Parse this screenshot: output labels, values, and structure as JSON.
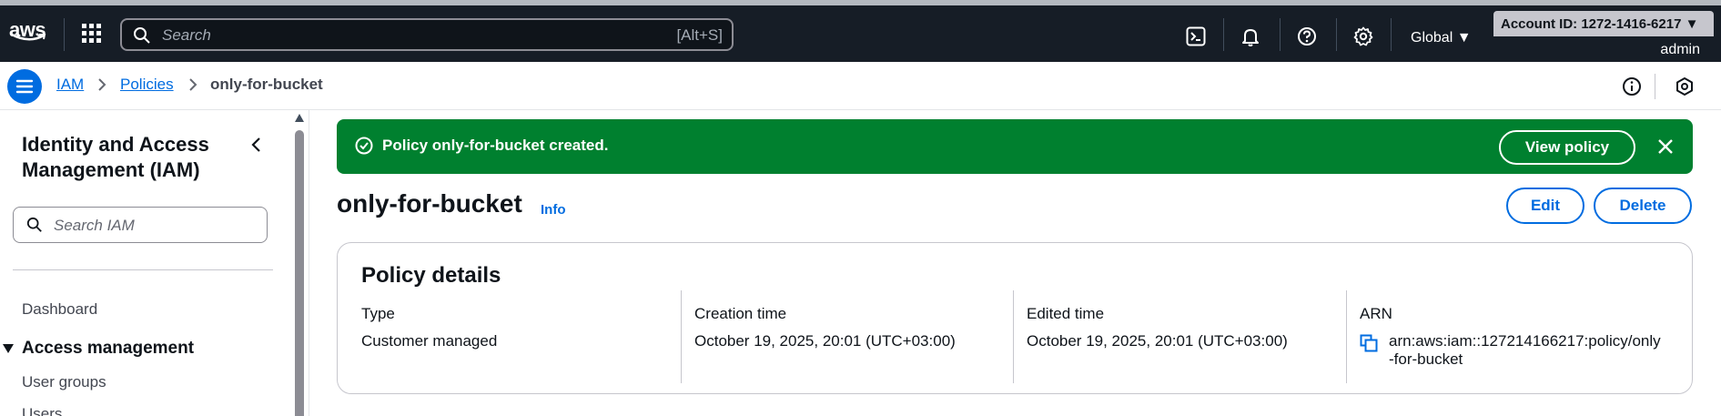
{
  "topnav": {
    "logo": "aws",
    "search_placeholder": "Search",
    "search_shortcut": "[Alt+S]",
    "region": "Global ▼",
    "account": "Account ID: 1272-1416-6217 ▼",
    "user": "admin",
    "icons": [
      "services-grid-icon",
      "cloudshell-icon",
      "bell-icon",
      "help-icon",
      "gear-icon"
    ]
  },
  "breadcrumb": {
    "items": [
      "IAM",
      "Policies",
      "only-for-bucket"
    ]
  },
  "sidebar": {
    "title": "Identity and Access Management (IAM)",
    "search_placeholder": "Search IAM",
    "items": {
      "dashboard": "Dashboard",
      "access_management": "Access management",
      "user_groups": "User groups",
      "users": "Users"
    }
  },
  "flash": {
    "message": "Policy only-for-bucket created.",
    "action": "View policy",
    "color": "#00802f"
  },
  "page": {
    "title": "only-for-bucket",
    "info": "Info",
    "edit": "Edit",
    "delete": "Delete"
  },
  "details": {
    "title": "Policy details",
    "type_label": "Type",
    "type_value": "Customer managed",
    "creation_label": "Creation time",
    "creation_value": "October 19, 2025, 20:01 (UTC+03:00)",
    "edited_label": "Edited time",
    "edited_value": "October 19, 2025, 20:01 (UTC+03:00)",
    "arn_label": "ARN",
    "arn_value": "arn:aws:iam::127214166217:policy/only-for-bucket"
  },
  "colors": {
    "nav_bg": "#161d26",
    "link": "#006ce0",
    "success": "#00802f"
  }
}
